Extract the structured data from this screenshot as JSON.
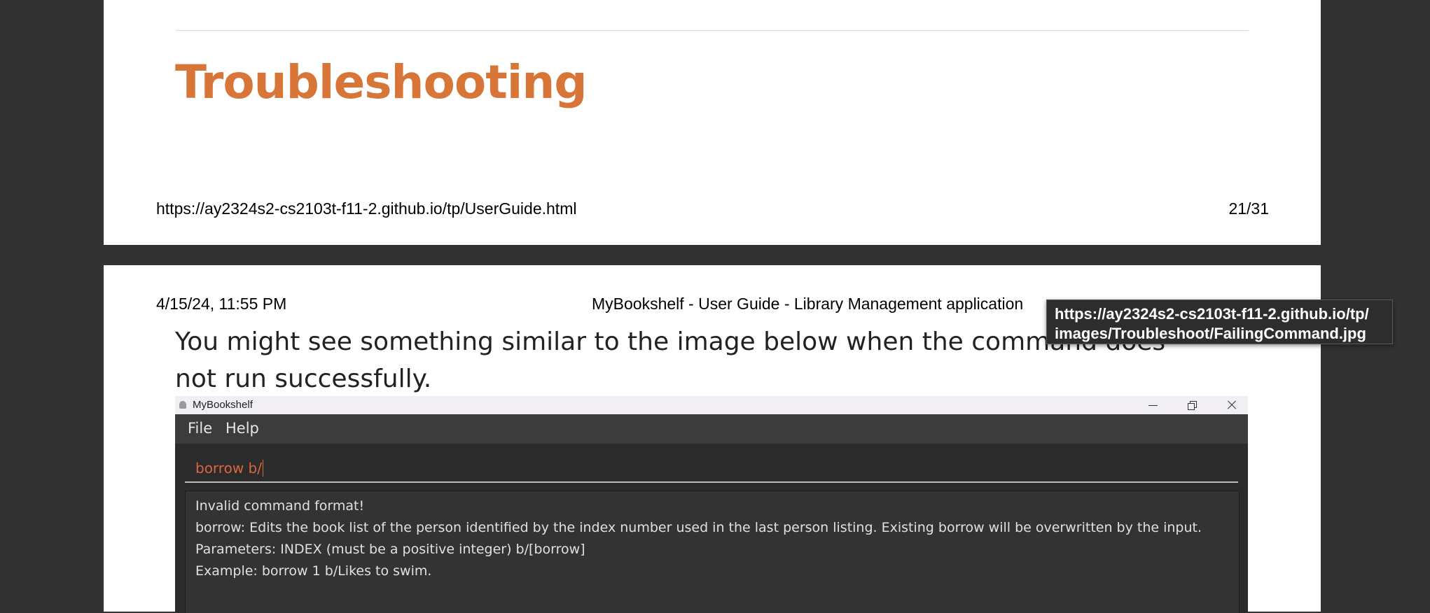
{
  "viewer": {
    "background_color": "#323232"
  },
  "page1": {
    "heading": "Troubleshooting",
    "heading_color": "#d8763a",
    "footer_url": "https://ay2324s2-cs2103t-f11-2.github.io/tp/UserGuide.html",
    "page_number": "21/31"
  },
  "page2": {
    "header_date": "4/15/24, 11:55 PM",
    "header_title": "MyBookshelf - User Guide - Library Management application",
    "paragraph": "You might see something similar to the image below when the command does not run successfully."
  },
  "app_screenshot": {
    "window_title": "MyBookshelf",
    "window_controls": {
      "minimize_icon": "minimize-icon",
      "restore_icon": "restore-icon",
      "close_icon": "close-icon"
    },
    "menu": [
      "File",
      "Help"
    ],
    "command_input": "borrow b/",
    "command_text_color": "#d8673e",
    "result_lines": [
      "Invalid command format!",
      "borrow: Edits the book list of the person identified by the index number used in the last person listing. Existing borrow will be overwritten by the input.",
      "Parameters: INDEX (must be a positive integer) b/[borrow]",
      "Example: borrow 1 b/Likes to swim."
    ]
  },
  "tooltip": {
    "line1": "https://ay2324s2-cs2103t-f11-2.github.io/tp/",
    "line2": "images/Troubleshoot/FailingCommand.jpg"
  }
}
